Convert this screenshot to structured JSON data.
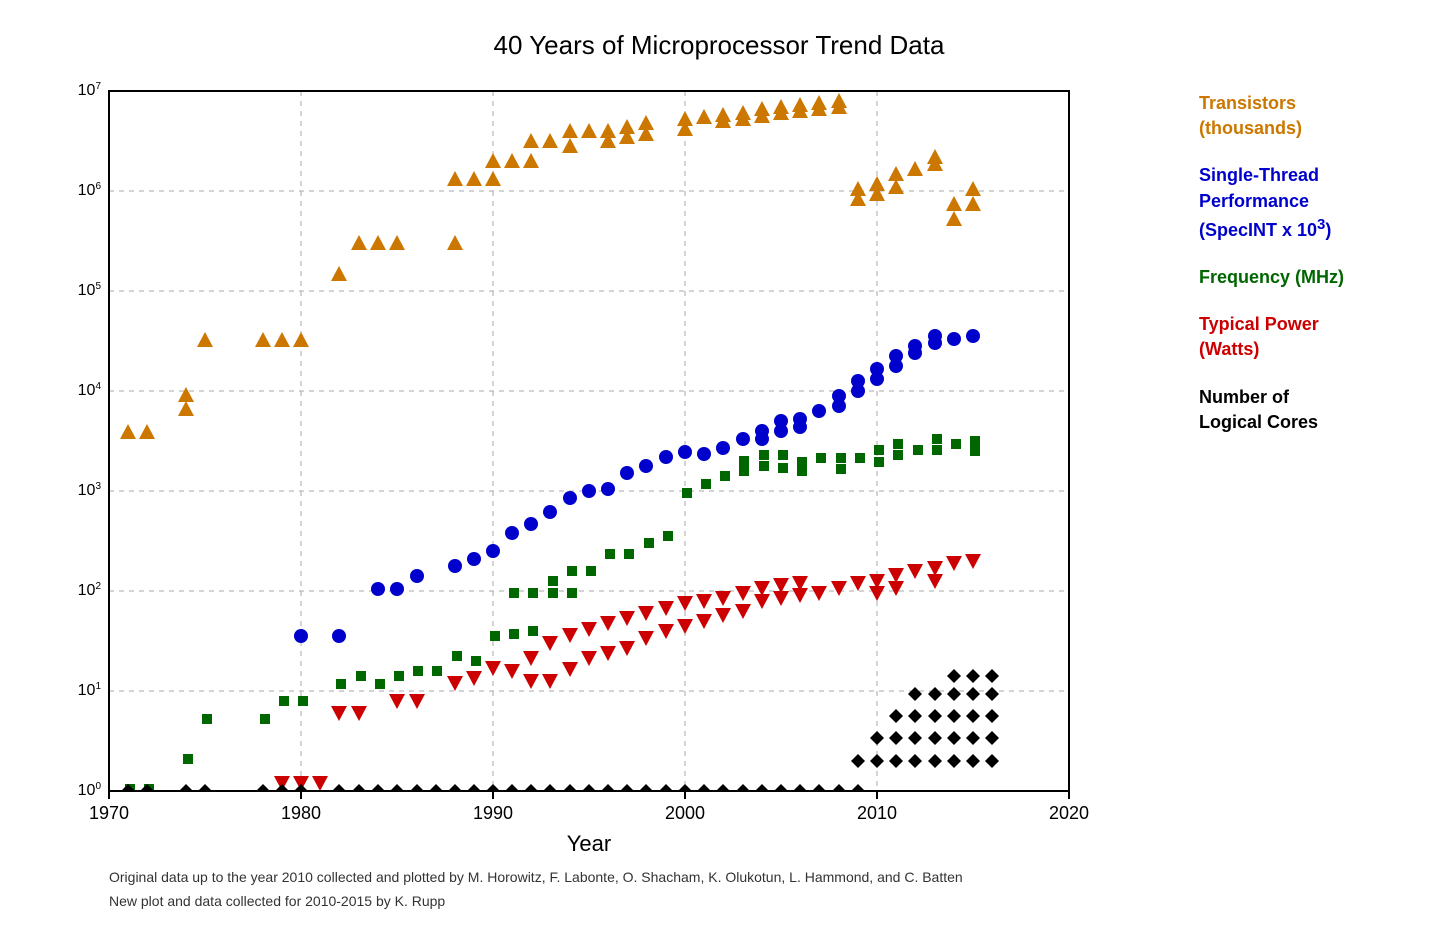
{
  "title": "40 Years of Microprocessor Trend Data",
  "xAxisLabel": "Year",
  "footer": [
    "Original data up to the year 2010 collected and plotted by M. Horowitz, F. Labonte, O. Shacham, K. Olukotun, L. Hammond, and C. Batten",
    "New plot and data collected for 2010-2015 by K. Rupp"
  ],
  "legend": {
    "transistors": "Transistors\n(thousands)",
    "singleThread": "Single-Thread\nPerformance\n(SpecINT x 10³)",
    "frequency": "Frequency (MHz)",
    "power": "Typical Power\n(Watts)",
    "cores": "Number of\nLogical Cores"
  },
  "colors": {
    "transistors": "#cc7700",
    "singleThread": "#0000cc",
    "frequency": "#006600",
    "power": "#cc0000",
    "cores": "#000000",
    "grid": "#aaaaaa"
  }
}
